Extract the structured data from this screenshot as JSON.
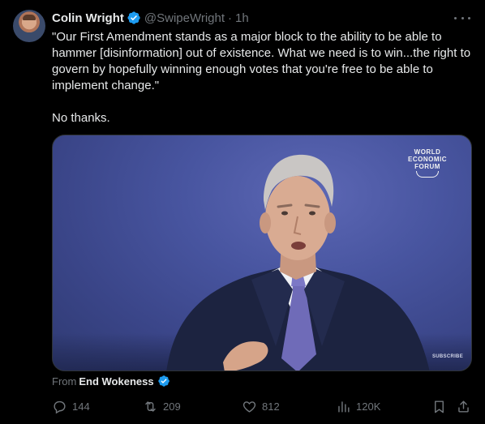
{
  "tweet": {
    "author_name": "Colin Wright",
    "handle": "@SwipeWright",
    "separator": "·",
    "time": "1h",
    "text_quote": "\"Our First Amendment stands as a major block to the ability to be able to hammer [disinformation] out of existence. What we need is to win...the right to govern by hopefully winning enough votes that you're free to be able to implement change.\"",
    "text_comment": "No thanks.",
    "verified": true
  },
  "media": {
    "watermark": "WORLD\nECONOMIC\nFORUM",
    "subscribe": "SUBSCRIBE"
  },
  "attribution": {
    "prefix": "From",
    "source": "End Wokeness"
  },
  "actions": {
    "replies": "144",
    "reposts": "209",
    "likes": "812",
    "views": "120K"
  },
  "colors": {
    "background": "#000000",
    "text": "#e7e9ea",
    "secondary": "#71767b",
    "verified": "#1d9bf0"
  },
  "icons": [
    "verified-badge-icon",
    "more-icon",
    "reply-icon",
    "repost-icon",
    "like-icon",
    "views-icon",
    "bookmark-icon",
    "share-icon"
  ]
}
